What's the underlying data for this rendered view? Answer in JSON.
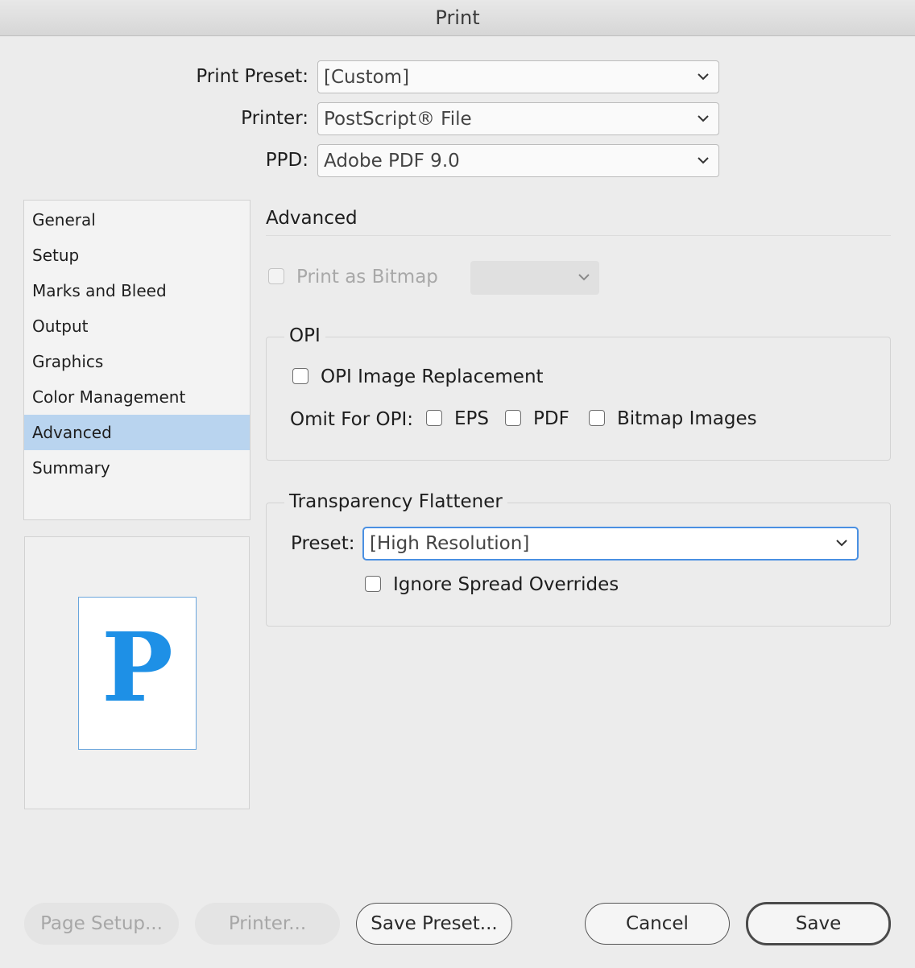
{
  "window": {
    "title": "Print"
  },
  "top_fields": {
    "print_preset": {
      "label": "Print Preset:",
      "value": "[Custom]"
    },
    "printer": {
      "label": "Printer:",
      "value": "PostScript® File"
    },
    "ppd": {
      "label": "PPD:",
      "value": "Adobe PDF 9.0"
    }
  },
  "sidebar": {
    "items": [
      {
        "label": "General"
      },
      {
        "label": "Setup"
      },
      {
        "label": "Marks and Bleed"
      },
      {
        "label": "Output"
      },
      {
        "label": "Graphics"
      },
      {
        "label": "Color Management"
      },
      {
        "label": "Advanced",
        "selected": true
      },
      {
        "label": "Summary"
      }
    ]
  },
  "preview": {
    "letter": "P",
    "color": "#1e90e6"
  },
  "advanced": {
    "title": "Advanced",
    "print_as_bitmap": {
      "label": "Print as Bitmap",
      "checked": false,
      "disabled": true,
      "select_value": ""
    },
    "opi": {
      "title": "OPI",
      "image_replacement": {
        "label": "OPI Image Replacement",
        "checked": false
      },
      "omit_label": "Omit For OPI:",
      "omit_eps": {
        "label": "EPS",
        "checked": false
      },
      "omit_pdf": {
        "label": "PDF",
        "checked": false
      },
      "omit_bitmap": {
        "label": "Bitmap Images",
        "checked": false
      }
    },
    "flattener": {
      "title": "Transparency Flattener",
      "preset_label": "Preset:",
      "preset_value": "[High Resolution]",
      "ignore_spread": {
        "label": "Ignore Spread Overrides",
        "checked": false
      }
    }
  },
  "buttons": {
    "page_setup": "Page Setup...",
    "printer": "Printer...",
    "save_preset": "Save Preset...",
    "cancel": "Cancel",
    "save": "Save"
  },
  "colors": {
    "selection": "#b9d4ef",
    "focus_ring": "#4a90e2",
    "accent": "#1e90e6"
  }
}
